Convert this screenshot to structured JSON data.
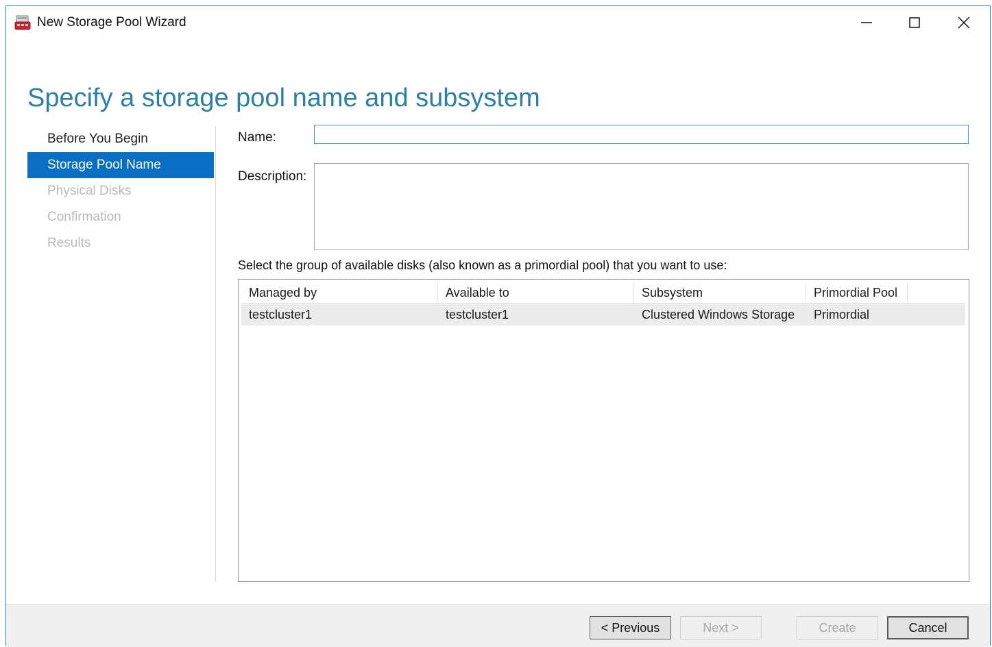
{
  "window": {
    "title": "New Storage Pool Wizard",
    "icon": "storage-pool-icon",
    "controls": [
      "minimize-icon",
      "maximize-icon",
      "close-icon"
    ]
  },
  "page": {
    "title": "Specify a storage pool name and subsystem"
  },
  "nav": {
    "items": [
      {
        "label": "Before You Begin",
        "state": "done"
      },
      {
        "label": "Storage Pool Name",
        "state": "active"
      },
      {
        "label": "Physical Disks",
        "state": "disabled"
      },
      {
        "label": "Confirmation",
        "state": "disabled"
      },
      {
        "label": "Results",
        "state": "disabled"
      }
    ]
  },
  "form": {
    "name_label": "Name:",
    "name_value": "",
    "description_label": "Description:",
    "description_value": "",
    "select_prompt": "Select the group of available disks (also known as a primordial pool) that you want to use:"
  },
  "grid": {
    "columns": [
      "Managed by",
      "Available to",
      "Subsystem",
      "Primordial Pool"
    ],
    "rows": [
      [
        "testcluster1",
        "testcluster1",
        "Clustered Windows Storage",
        "Primordial"
      ]
    ]
  },
  "buttons": {
    "previous": "< Previous",
    "next": "Next >",
    "create": "Create",
    "cancel": "Cancel"
  },
  "colors": {
    "accent": "#0a6fc2",
    "title": "#2e7fa6",
    "disabled_text": "#b9b9b9"
  }
}
